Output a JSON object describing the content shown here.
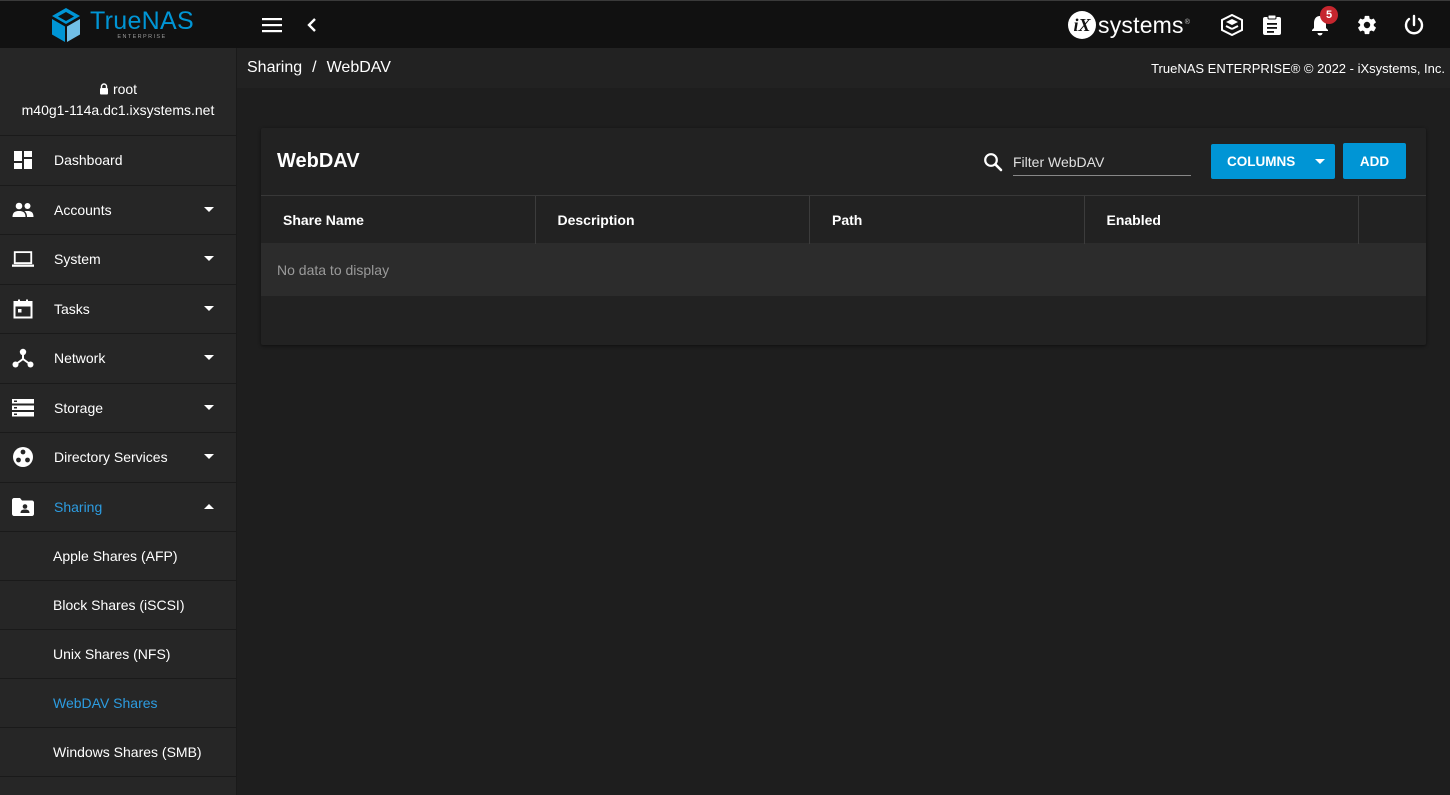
{
  "brand": {
    "name": "TrueNAS",
    "edition": "ENTERPRISE",
    "vendor": "systems",
    "vendor_mark": "iX",
    "vendor_tm": "®",
    "notification_count": "5"
  },
  "user": {
    "name": "root",
    "hostname": "m40g1-114a.dc1.ixsystems.net"
  },
  "sidebar": {
    "items": [
      {
        "label": "Dashboard"
      },
      {
        "label": "Accounts"
      },
      {
        "label": "System"
      },
      {
        "label": "Tasks"
      },
      {
        "label": "Network"
      },
      {
        "label": "Storage"
      },
      {
        "label": "Directory Services"
      },
      {
        "label": "Sharing"
      }
    ],
    "sharing_sub": [
      {
        "label": "Apple Shares (AFP)"
      },
      {
        "label": "Block Shares (iSCSI)"
      },
      {
        "label": "Unix Shares (NFS)"
      },
      {
        "label": "WebDAV Shares"
      },
      {
        "label": "Windows Shares (SMB)"
      }
    ]
  },
  "breadcrumb": {
    "parent": "Sharing",
    "separator": "/",
    "current": "WebDAV"
  },
  "copyright": "TrueNAS ENTERPRISE® © 2022 - iXsystems, Inc.",
  "card": {
    "title": "WebDAV",
    "filter_placeholder": "Filter WebDAV",
    "columns_label": "COLUMNS",
    "add_label": "ADD",
    "columns": [
      "Share Name",
      "Description",
      "Path",
      "Enabled"
    ],
    "empty_text": "No data to display"
  },
  "colors": {
    "accent": "#0095d5",
    "active_text": "#2d9ce0",
    "badge": "#c6262e"
  }
}
